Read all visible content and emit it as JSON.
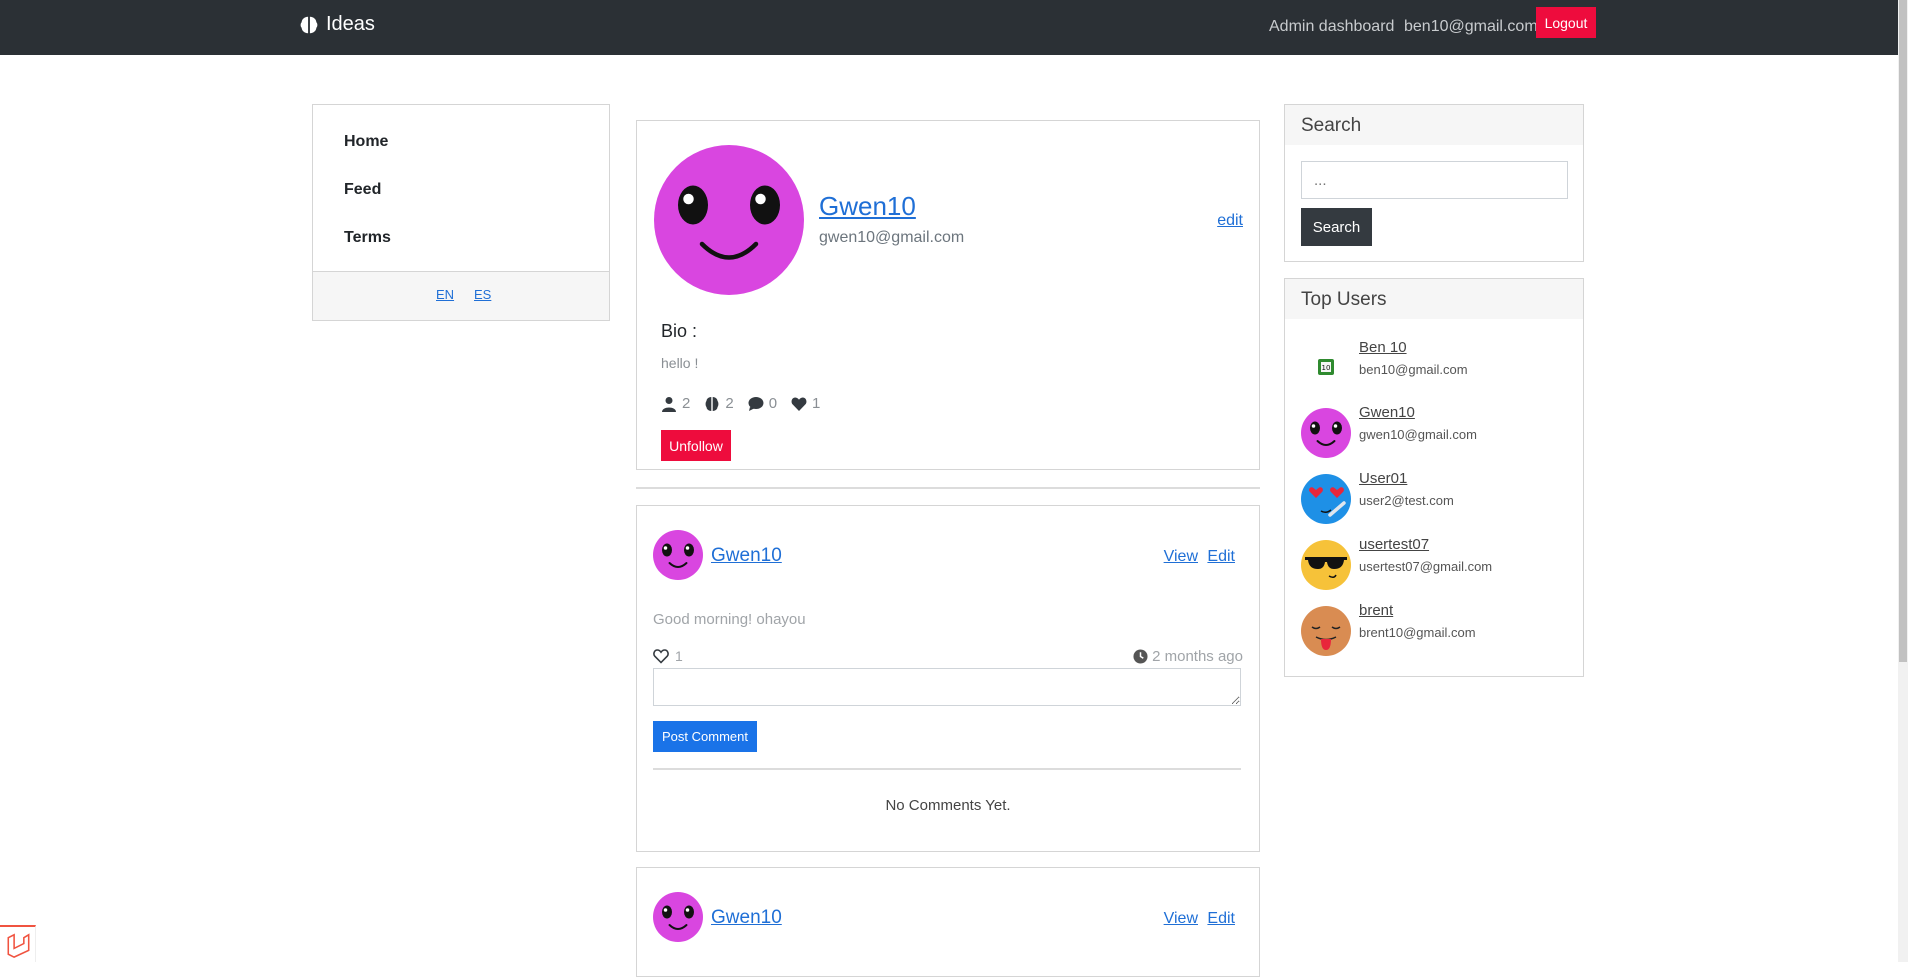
{
  "navbar": {
    "brand": "Ideas",
    "admin_link": "Admin dashboard",
    "user_email": "ben10@gmail.com",
    "logout_label": "Logout"
  },
  "left_nav": {
    "items": [
      {
        "label": "Home"
      },
      {
        "label": "Feed"
      },
      {
        "label": "Terms"
      }
    ],
    "languages": [
      "EN",
      "ES"
    ]
  },
  "profile": {
    "name": "Gwen10",
    "email": "gwen10@gmail.com",
    "edit_label": "edit",
    "bio_label": "Bio :",
    "bio": "hello !",
    "stats": {
      "followers": "2",
      "ideas": "2",
      "comments": "0",
      "likes": "1"
    },
    "unfollow_label": "Unfollow"
  },
  "posts": [
    {
      "author": "Gwen10",
      "view_label": "View",
      "edit_label": "Edit",
      "content": "Good morning! ohayou",
      "likes": "1",
      "time": "2 months ago",
      "post_comment_label": "Post Comment",
      "no_comments": "No Comments Yet."
    },
    {
      "author": "Gwen10",
      "view_label": "View",
      "edit_label": "Edit"
    }
  ],
  "search": {
    "title": "Search",
    "placeholder": "...",
    "button_label": "Search"
  },
  "top_users": {
    "title": "Top Users",
    "users": [
      {
        "name": "Ben 10",
        "email": "ben10@gmail.com",
        "avatar": "ben10-badge-icon"
      },
      {
        "name": "Gwen10",
        "email": "gwen10@gmail.com",
        "avatar": "smiley-purple-icon"
      },
      {
        "name": "User01",
        "email": "user2@test.com",
        "avatar": "heart-eyes-blue-icon"
      },
      {
        "name": "usertest07",
        "email": "usertest07@gmail.com",
        "avatar": "sunglasses-yellow-icon"
      },
      {
        "name": "brent",
        "email": "brent10@gmail.com",
        "avatar": "tongue-tan-icon"
      }
    ]
  },
  "colors": {
    "navbar": "#2b3035",
    "danger": "#ee0c3d",
    "primary": "#1a73e8",
    "avatar_purple": "#d946e0"
  }
}
